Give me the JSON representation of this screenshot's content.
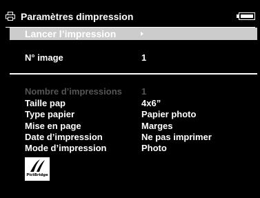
{
  "title": "Paramètres dimpression",
  "launch": {
    "label": "Lancer l’impression"
  },
  "image": {
    "label": "N° image",
    "value": "1"
  },
  "settings": [
    {
      "label": "Nombre d’impressions",
      "value": "1",
      "disabled": true
    },
    {
      "label": "Taille pap",
      "value": "4x6”",
      "disabled": false
    },
    {
      "label": "Type papier",
      "value": "Papier photo",
      "disabled": false
    },
    {
      "label": "Mise en page",
      "value": "Marges",
      "disabled": false
    },
    {
      "label": "Date d’impression",
      "value": "Ne pas imprimer",
      "disabled": false
    },
    {
      "label": "Mode d’impression",
      "value": "Photo",
      "disabled": false
    }
  ],
  "logo": {
    "text": "PictBridge"
  },
  "icons": {
    "title": "printer-icon",
    "status": "battery-icon",
    "launch": "arrow-right-icon"
  },
  "colors": {
    "background": "#000000",
    "text": "#ffffff",
    "disabled_text": "#555555",
    "highlight": "#cccccc"
  }
}
